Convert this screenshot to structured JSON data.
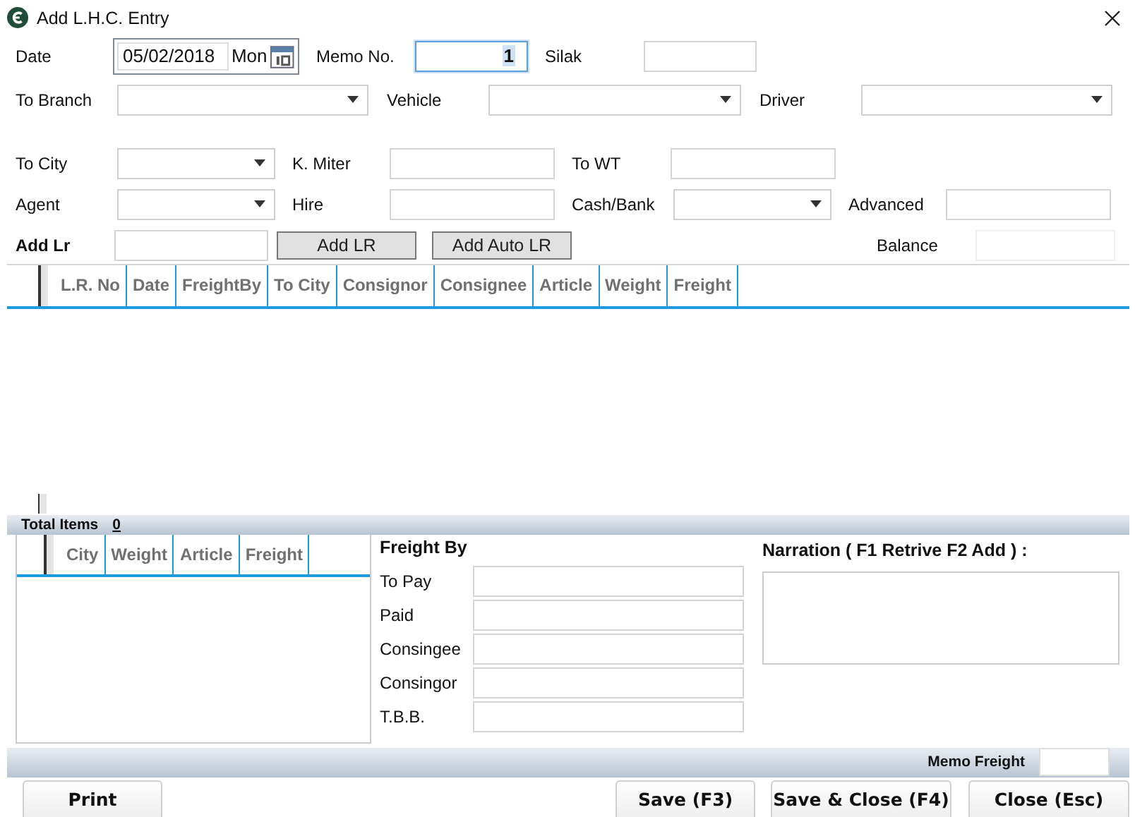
{
  "window": {
    "title": "Add L.H.C. Entry"
  },
  "header_rows": [
    [
      {
        "label": "Date",
        "kind": "date",
        "value": "05/02/2018",
        "day": "Mon",
        "focused": false
      },
      {
        "label": "Memo No.",
        "kind": "text",
        "value": "1",
        "focused": true
      },
      {
        "label": "Silak",
        "kind": "text",
        "focused": false
      }
    ],
    [
      {
        "label": "To Branch",
        "kind": "dropdown",
        "focused": false
      },
      {
        "label": "Vehicle",
        "kind": "dropdown",
        "focused": false
      },
      {
        "label": "Driver",
        "kind": "dropdown",
        "focused": false
      }
    ],
    [
      {
        "label": "To City",
        "kind": "dropdown",
        "focused": false
      },
      {
        "label": "K. Miter",
        "kind": "text",
        "focused": false
      },
      {
        "label": "To WT",
        "kind": "text",
        "focused": false
      }
    ],
    [
      {
        "label": "Agent",
        "kind": "dropdown",
        "focused": false
      },
      {
        "label": "Hire",
        "kind": "text",
        "focused": false
      },
      {
        "label": "Cash/Bank",
        "kind": "dropdown",
        "focused": false
      },
      {
        "label": "Advanced",
        "kind": "text",
        "focused": false
      }
    ]
  ],
  "add_lr": {
    "label": "Add Lr",
    "buttons": [
      "Add LR",
      "Add Auto LR"
    ],
    "balance_label": "Balance"
  },
  "lr_table": {
    "columns": [
      "L.R. No",
      "Date",
      "FreightBy",
      "To City",
      "Consignor",
      "Consignee",
      "Article",
      "Weight",
      "Freight"
    ]
  },
  "total_items": {
    "label": "Total Items",
    "value": "0"
  },
  "summary_table": {
    "columns": [
      "City",
      "Weight",
      "Article",
      "Freight"
    ]
  },
  "freight_by": {
    "title": "Freight By",
    "rows": [
      "To Pay",
      "Paid",
      "Consingee",
      "Consingor",
      "T.B.B."
    ]
  },
  "narration": {
    "label": "Narration ( F1 Retrive F2 Add ) :"
  },
  "memo_freight": {
    "label": "Memo Freight"
  },
  "buttons": [
    "Print",
    "Save (F3)",
    "Save & Close (F4)",
    "Close (Esc)"
  ]
}
